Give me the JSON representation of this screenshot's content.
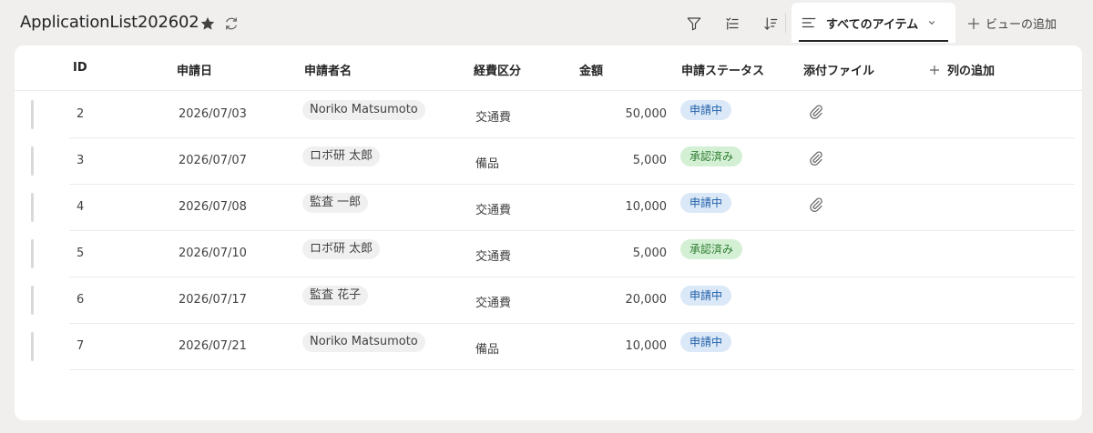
{
  "header": {
    "title": "ApplicationList202602",
    "view_label": "すべてのアイテム",
    "add_view_label": "ビューの追加"
  },
  "columns": {
    "id": "ID",
    "date": "申請日",
    "applicant": "申請者名",
    "category": "経費区分",
    "amount": "金額",
    "status": "申請ステータス",
    "attachment": "添付ファイル",
    "add_column": "列の追加"
  },
  "colors": {
    "status_pending_bg": "#dbe8f7",
    "status_pending_fg": "#1f5fa8",
    "status_approved_bg": "#d4f0d4",
    "status_approved_fg": "#2e7d32"
  },
  "rows": [
    {
      "id": "2",
      "date": "2026/07/03",
      "applicant": "Noriko Matsumoto",
      "category": "交通費",
      "amount": "50,000",
      "status": "申請中",
      "status_kind": "pending",
      "attachment": true
    },
    {
      "id": "3",
      "date": "2026/07/07",
      "applicant": "ロボ研 太郎",
      "category": "備品",
      "amount": "5,000",
      "status": "承認済み",
      "status_kind": "approved",
      "attachment": true
    },
    {
      "id": "4",
      "date": "2026/07/08",
      "applicant": "監査 一郎",
      "category": "交通費",
      "amount": "10,000",
      "status": "申請中",
      "status_kind": "pending",
      "attachment": true
    },
    {
      "id": "5",
      "date": "2026/07/10",
      "applicant": "ロボ研 太郎",
      "category": "交通費",
      "amount": "5,000",
      "status": "承認済み",
      "status_kind": "approved",
      "attachment": false
    },
    {
      "id": "6",
      "date": "2026/07/17",
      "applicant": "監査 花子",
      "category": "交通費",
      "amount": "20,000",
      "status": "申請中",
      "status_kind": "pending",
      "attachment": false
    },
    {
      "id": "7",
      "date": "2026/07/21",
      "applicant": "Noriko Matsumoto",
      "category": "備品",
      "amount": "10,000",
      "status": "申請中",
      "status_kind": "pending",
      "attachment": false
    }
  ]
}
